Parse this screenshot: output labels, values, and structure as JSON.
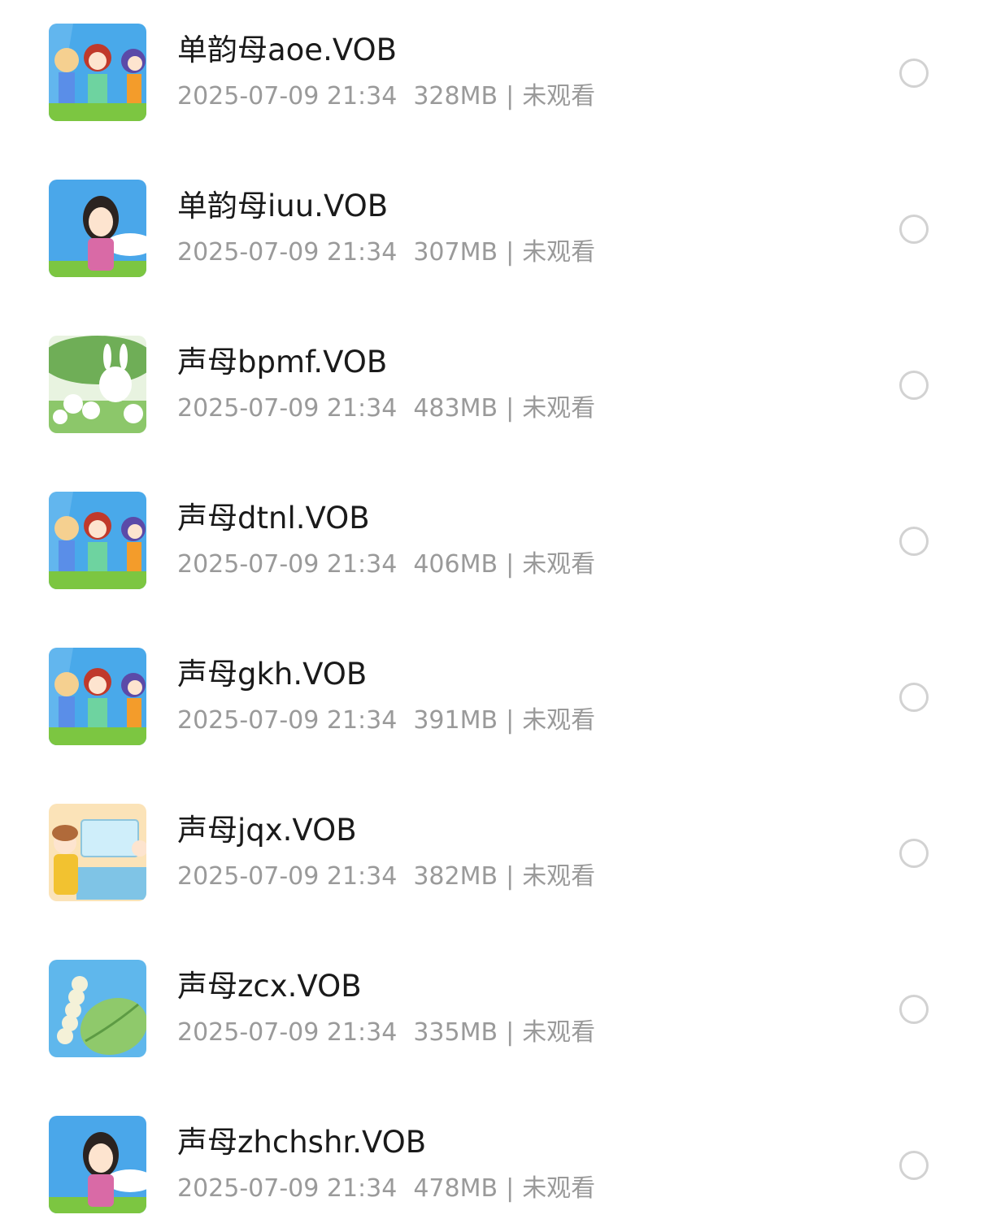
{
  "files": [
    {
      "title": "单韵母aoe.VOB",
      "date": "2025-07-09 21:34",
      "size": "328MB",
      "status": "未观看",
      "thumb": "three-girls-thumbnail",
      "checked": false
    },
    {
      "title": "单韵母iuu.VOB",
      "date": "2025-07-09 21:34",
      "size": "307MB",
      "status": "未观看",
      "thumb": "girl-thumbnail",
      "checked": false
    },
    {
      "title": "声母bpmf.VOB",
      "date": "2025-07-09 21:34",
      "size": "483MB",
      "status": "未观看",
      "thumb": "rabbits-thumbnail",
      "checked": false
    },
    {
      "title": "声母dtnl.VOB",
      "date": "2025-07-09 21:34",
      "size": "406MB",
      "status": "未观看",
      "thumb": "three-girls-thumbnail",
      "checked": false
    },
    {
      "title": "声母gkh.VOB",
      "date": "2025-07-09 21:34",
      "size": "391MB",
      "status": "未观看",
      "thumb": "three-girls-thumbnail",
      "checked": false
    },
    {
      "title": "声母jqx.VOB",
      "date": "2025-07-09 21:34",
      "size": "382MB",
      "status": "未观看",
      "thumb": "washing-thumbnail",
      "checked": false
    },
    {
      "title": "声母zcx.VOB",
      "date": "2025-07-09 21:34",
      "size": "335MB",
      "status": "未观看",
      "thumb": "caterpillar-thumbnail",
      "checked": false
    },
    {
      "title": "声母zhchshr.VOB",
      "date": "2025-07-09 21:34",
      "size": "478MB",
      "status": "未观看",
      "thumb": "girl-thumbnail",
      "checked": false
    }
  ],
  "colors": {
    "title": "#1a1a1a",
    "meta": "#9a9a9a",
    "radio_border": "#d2d2d2",
    "sky": "#3fa3e6",
    "grass": "#7cc641"
  }
}
